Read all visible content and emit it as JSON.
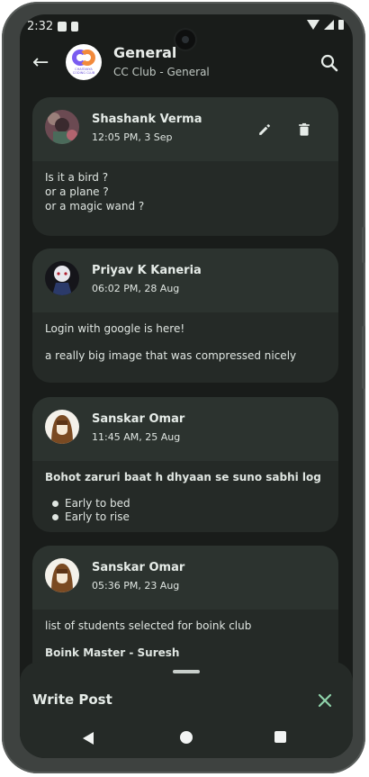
{
  "status_bar": {
    "time": "2:32"
  },
  "app_bar": {
    "title": "General",
    "subtitle": "CC Club - General",
    "logo_text": "CHAITANYA CODING CLUB"
  },
  "posts": [
    {
      "author": "Shashank Verma",
      "time": "12:05 PM, 3 Sep",
      "lines": [
        "Is it a bird ?",
        "or a plane ?",
        "or a magic wand ?"
      ],
      "editable": true
    },
    {
      "author": "Priyav K Kaneria",
      "time": "06:02 PM, 28 Aug",
      "lines": [
        "Login with google is here!",
        "a really big image that was compressed nicely"
      ]
    },
    {
      "author": "Sanskar Omar",
      "time": "11:45 AM, 25 Aug",
      "heading": "Bohot zaruri baat h dhyaan se suno sabhi log",
      "bullets": [
        "Early to bed",
        "Early to rise"
      ]
    },
    {
      "author": "Sanskar Omar",
      "time": "05:36 PM, 23 Aug",
      "lines": [
        "list of students selected for boink club"
      ],
      "heading": "Boink Master - Suresh"
    }
  ],
  "bottom_sheet": {
    "title": "Write Post"
  },
  "colors": {
    "background": "#191c1a",
    "card": "#252a27",
    "card_header": "#2c332f",
    "accent": "#8fd3aa"
  }
}
